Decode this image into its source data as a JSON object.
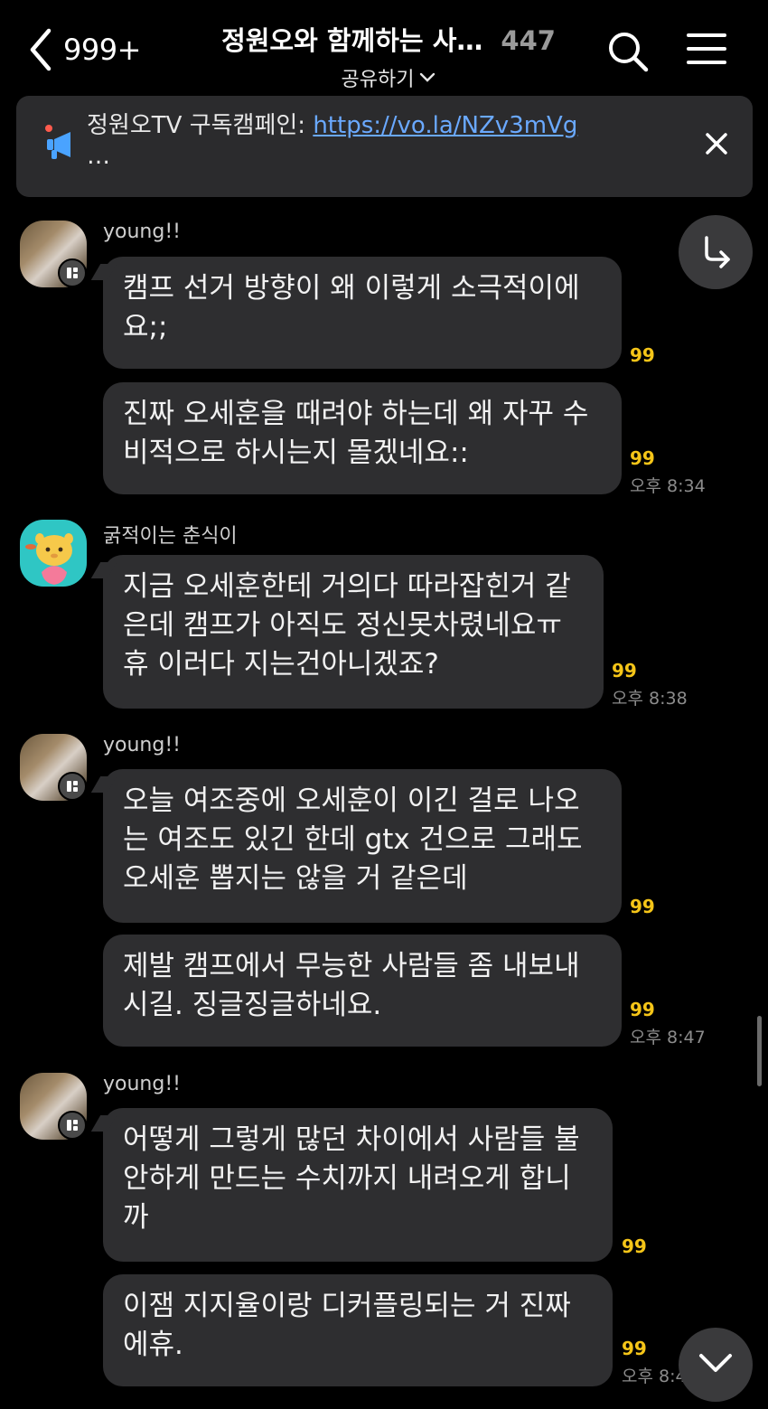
{
  "header": {
    "back_count": "999+",
    "room_title": "정원오와 함께하는 사…",
    "member_count": "447",
    "share_label": "공유하기"
  },
  "notice": {
    "prefix": "정원오TV 구독캠페인: ",
    "link": "https://vo.la/NZv3mVg",
    "more": "…"
  },
  "messages": [
    {
      "sender": "young!!",
      "text": "캠프 선거 방향이 왜 이렇게 소극적이에요;;",
      "unread": "99",
      "time": ""
    },
    {
      "sender": "",
      "text": "진짜 오세훈을 때려야 하는데 왜 자꾸 수비적으로 하시는지 몰겠네요::",
      "unread": "99",
      "time": "오후 8:34"
    },
    {
      "sender": "굵적이는 춘식이",
      "text": "지금 오세훈한테 거의다 따라잡힌거 같은데 캠프가 아직도 정신못차렸네요ㅠ 휴 이러다 지는건아니겠죠?",
      "unread": "99",
      "time": "오후 8:38"
    },
    {
      "sender": "young!!",
      "text": "오늘 여조중에 오세훈이 이긴 걸로 나오는 여조도 있긴 한데 gtx 건으로 그래도 오세훈 뽑지는 않을 거 같은데",
      "unread": "99",
      "time": ""
    },
    {
      "sender": "",
      "text": "제발 캠프에서 무능한 사람들 좀 내보내시길. 징글징글하네요.",
      "unread": "99",
      "time": "오후 8:47"
    },
    {
      "sender": "young!!",
      "text": "어떻게 그렇게 많던 차이에서 사람들 불안하게 만드는 수치까지 내려오게 합니까",
      "unread": "99",
      "time": ""
    },
    {
      "sender": "",
      "text": "이잼 지지율이랑 디커플링되는 거 진짜 에휴.",
      "unread": "99",
      "time": "오후 8:4"
    }
  ]
}
